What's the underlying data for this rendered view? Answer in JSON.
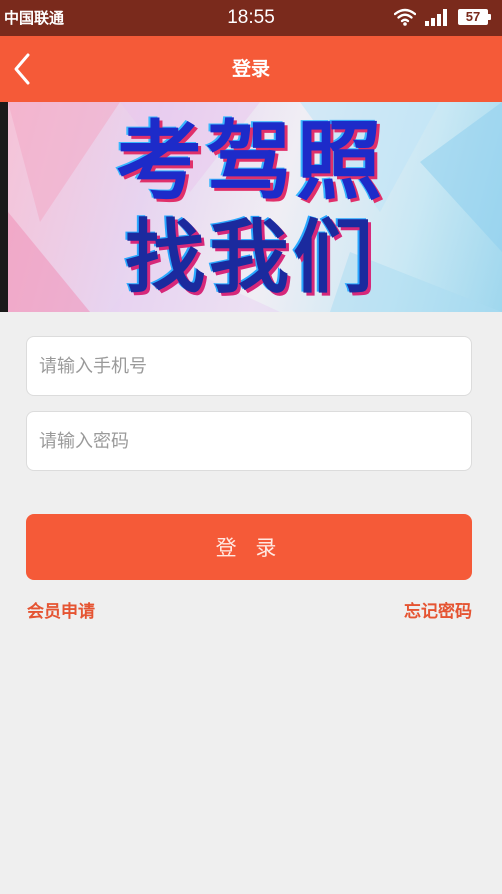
{
  "status_bar": {
    "carrier": "中国联通",
    "time": "18:55",
    "battery": "57"
  },
  "header": {
    "title": "登录"
  },
  "banner": {
    "line1": "考驾照",
    "line2": "找我们"
  },
  "form": {
    "phone_placeholder": "请输入手机号",
    "password_placeholder": "请输入密码",
    "login_label": "登 录"
  },
  "links": {
    "register": "会员申请",
    "forgot_password": "忘记密码"
  },
  "colors": {
    "accent": "#f55a38",
    "status_bar": "#7a2a1c",
    "link": "#e55432",
    "background": "#efefef"
  },
  "icons": {
    "back": "chevron-left-icon",
    "wifi": "wifi-icon",
    "signal": "signal-icon",
    "battery": "battery-icon"
  }
}
